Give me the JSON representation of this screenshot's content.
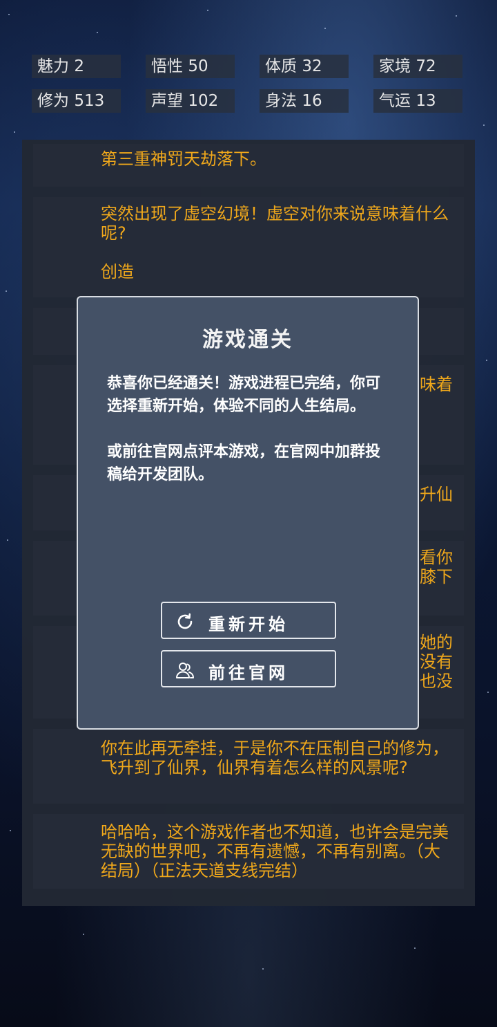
{
  "stats": [
    {
      "label": "魅力",
      "value": "2"
    },
    {
      "label": "悟性",
      "value": "50"
    },
    {
      "label": "体质",
      "value": "32"
    },
    {
      "label": "家境",
      "value": "72"
    },
    {
      "label": "修为",
      "value": "513"
    },
    {
      "label": "声望",
      "value": "102"
    },
    {
      "label": "身法",
      "value": "16"
    },
    {
      "label": "气运",
      "value": "13"
    }
  ],
  "log": {
    "entry1": "第三重神罚天劫落下。",
    "entry2": "突然出现了虚空幻境！虚空对你来说意味着什么呢?",
    "entry2_choice": "创造",
    "entry4_fragment": "味着",
    "entry5_fragment": "升仙",
    "entry6_fragment_1": "看你",
    "entry6_fragment_2": "膝下",
    "entry7_fragment_1": "她的",
    "entry7_fragment_2": "没有",
    "entry7_fragment_3": "也没",
    "entry8": "你在此再无牵挂，于是你不在压制自己的修为，飞升到了仙界，仙界有着怎么样的风景呢?",
    "entry9": "哈哈哈，这个游戏作者也不知道，也许会是完美无缺的世界吧，不再有遗憾，不再有别离。（大结局）（正法天道支线完结）"
  },
  "modal": {
    "title": "游戏通关",
    "body1": "恭喜你已经通关！游戏进程已完结，你可选择重新开始，体验不同的人生结局。",
    "body2": "或前往官网点评本游戏，在官网中加群投稿给开发团队。",
    "restart_label": "重新开始",
    "website_label": "前往官网"
  },
  "icons": {
    "restart": "refresh-icon",
    "website": "users-icon"
  },
  "colors": {
    "log_text": "#f0a81b",
    "modal_bg": "#445166"
  }
}
